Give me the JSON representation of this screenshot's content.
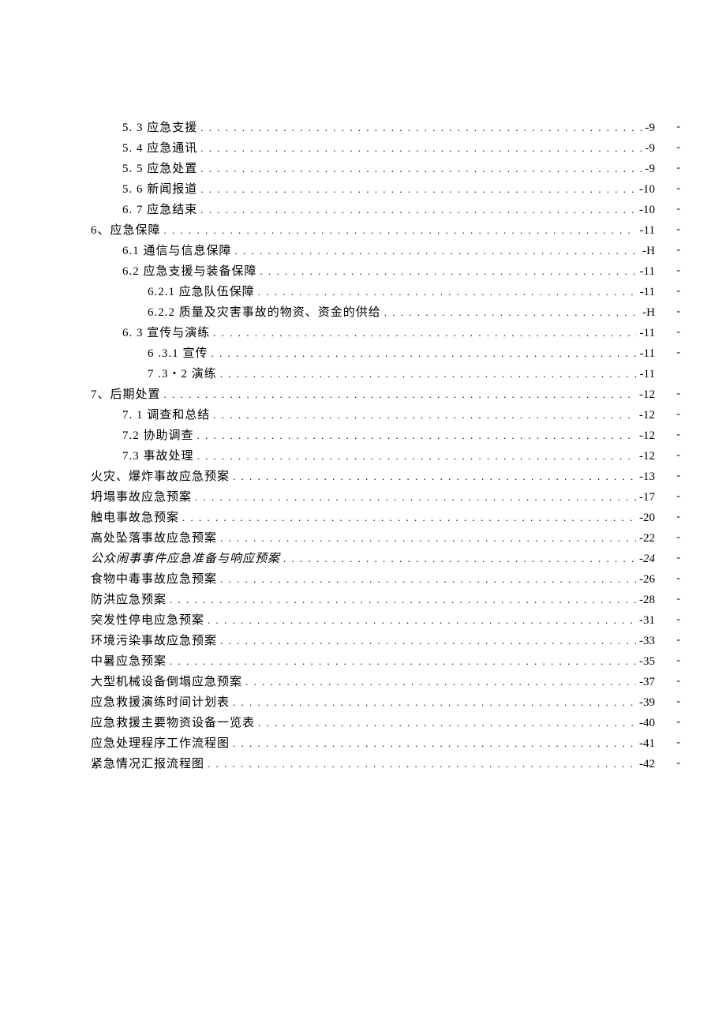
{
  "toc": [
    {
      "indent": 1,
      "label": "5.   3 应急支援",
      "page": "-9",
      "dash": true
    },
    {
      "indent": 1,
      "label": "5.   4 应急通讯",
      "page": "-9",
      "dash": true
    },
    {
      "indent": 1,
      "label": "5.   5 应急处置",
      "page": "-9",
      "dash": true
    },
    {
      "indent": 1,
      "label": "5.   6 新闻报道",
      "page": "-10",
      "dash": true
    },
    {
      "indent": 1,
      "label": "6.   7 应急结束",
      "page": "-10",
      "dash": true
    },
    {
      "indent": 0,
      "label": "6、应急保障",
      "page": "-11",
      "dash": true
    },
    {
      "indent": 1,
      "label": "6.1    通信与信息保障",
      "page": "-H",
      "dash": true
    },
    {
      "indent": 1,
      "label": "6.2    应急支援与装备保障",
      "page": "-11",
      "dash": true
    },
    {
      "indent": 2,
      "label": "6.2.1 应急队伍保障",
      "page": "-11",
      "dash": true
    },
    {
      "indent": 2,
      "label": "6.2.2 质量及灾害事故的物资、资金的供给",
      "page": "-H",
      "dash": true
    },
    {
      "indent": 1,
      "label": "6.   3 宣传与演练",
      "page": "-11",
      "dash": true
    },
    {
      "indent": 2,
      "label": "6    .3.1 宣传",
      "page": "-11",
      "dash": true
    },
    {
      "indent": 2,
      "label": "7    .3・2 演练",
      "page": "-11",
      "dash": false
    },
    {
      "indent": 0,
      "label": "7、后期处置",
      "page": "-12",
      "dash": true
    },
    {
      "indent": 1,
      "label": "7.   1 调查和总结",
      "page": "-12",
      "dash": true
    },
    {
      "indent": 1,
      "label": "7.2 协助调查",
      "page": "-12",
      "dash": true
    },
    {
      "indent": 1,
      "label": "7.3 事故处理",
      "page": "-12",
      "dash": true
    },
    {
      "indent": 0,
      "label": "火灾、爆炸事故应急预案",
      "page": "-13",
      "dash": true
    },
    {
      "indent": 0,
      "label": "坍塌事故应急预案",
      "page": "-17",
      "dash": true
    },
    {
      "indent": 0,
      "label": "触电事故急预案",
      "page": "-20",
      "dash": true
    },
    {
      "indent": 0,
      "label": "高处坠落事故应急预案",
      "page": "-22",
      "dash": true
    },
    {
      "indent": 0,
      "label": "公众闹事事件应急准备与响应预案",
      "page": "-24",
      "dash": true,
      "italic": true
    },
    {
      "indent": 0,
      "label": "食物中毒事故应急预案",
      "page": "-26",
      "dash": true
    },
    {
      "indent": 0,
      "label": "防洪应急预案",
      "page": "-28",
      "dash": true
    },
    {
      "indent": 0,
      "label": "突发性停电应急预案",
      "page": "-31",
      "dash": true
    },
    {
      "indent": 0,
      "label": "环境污染事故应急预案",
      "page": "-33",
      "dash": true
    },
    {
      "indent": 0,
      "label": "中暑应急预案",
      "page": "-35",
      "dash": true
    },
    {
      "indent": 0,
      "label": "大型机械设备倒塌应急预案",
      "page": "-37",
      "dash": true
    },
    {
      "indent": 0,
      "label": "应急救援演练时间计划表",
      "page": "-39",
      "dash": true
    },
    {
      "indent": 0,
      "label": "应急救援主要物资设备一览表",
      "page": "-40",
      "dash": true
    },
    {
      "indent": 0,
      "label": "应急处理程序工作流程图",
      "page": "-41",
      "dash": true
    },
    {
      "indent": 0,
      "label": "紧急情况汇报流程图",
      "page": "-42",
      "dash": true
    }
  ],
  "dash_char": "-"
}
